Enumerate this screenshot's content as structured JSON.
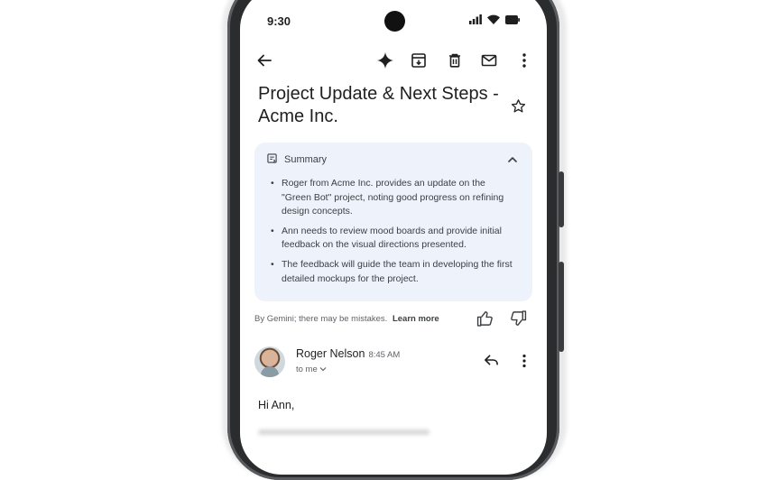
{
  "status_bar": {
    "time": "9:30"
  },
  "app_bar": {
    "icons": [
      "back-arrow-icon",
      "gemini-sparkle-icon",
      "archive-icon",
      "delete-icon",
      "mail-icon",
      "more-vert-icon"
    ]
  },
  "email": {
    "subject": "Project Update & Next Steps - Acme Inc.",
    "starred": false
  },
  "summary": {
    "title": "Summary",
    "bullets": [
      "Roger from Acme Inc. provides an update on the \"Green Bot\" project, noting good progress on refining design concepts.",
      "Ann needs to review mood boards and provide initial feedback on the visual directions presented.",
      "The feedback will guide the team in developing the first detailed mockups for the project."
    ],
    "disclaimer": "By Gemini; there may be mistakes.",
    "learn_more": "Learn more"
  },
  "message": {
    "sender_name": "Roger Nelson",
    "time": "8:45 AM",
    "recipient": "to me",
    "greeting": "Hi Ann,"
  },
  "colors": {
    "summary_bg": "#eef2fb",
    "frame": "#2b2c2e"
  }
}
